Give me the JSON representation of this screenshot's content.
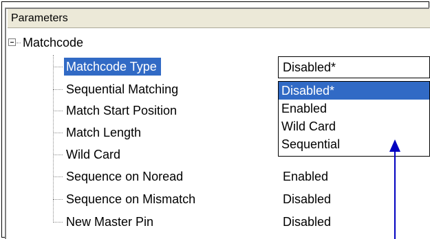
{
  "header": {
    "title": "Parameters"
  },
  "tree": {
    "root_label": "Matchcode",
    "items": [
      {
        "label": "Matchcode Type",
        "value": "Disabled*"
      },
      {
        "label": "Sequential Matching",
        "value": ""
      },
      {
        "label": "Match Start Position",
        "value": ""
      },
      {
        "label": "Match Length",
        "value": ""
      },
      {
        "label": "Wild Card",
        "value": ""
      },
      {
        "label": "Sequence on Noread",
        "value": "Enabled"
      },
      {
        "label": "Sequence on Mismatch",
        "value": "Disabled"
      },
      {
        "label": "New Master Pin",
        "value": "Disabled"
      }
    ]
  },
  "combo": {
    "selected_value": "Disabled*"
  },
  "dropdown": {
    "options": [
      "Disabled*",
      "Enabled",
      "Wild Card",
      "Sequential"
    ],
    "highlighted_index": 0
  },
  "colors": {
    "selection": "#316ac5",
    "arrow": "#0000c0"
  }
}
